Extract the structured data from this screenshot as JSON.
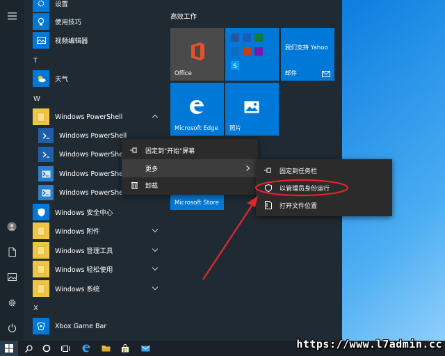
{
  "start_menu": {
    "apps": {
      "settings": "设置",
      "tips": "使用技巧",
      "video_editor": "视频编辑器",
      "letter_t": "T",
      "weather": "天气",
      "letter_w": "W",
      "powershell_folder": "Windows PowerShell",
      "ps_item_1": "Windows PowerShell",
      "ps_item_2": "Windows PowerShell",
      "ps_item_3": "Windows PowerShell",
      "ps_item_4": "Windows PowerShell",
      "security_center": "Windows 安全中心",
      "accessories": "Windows 附件",
      "admin_tools": "Windows 管理工具",
      "ease_of_access": "Windows 轻松使用",
      "system": "Windows 系统",
      "letter_x": "X",
      "xbox": "Xbox Game Bar"
    },
    "tiles": {
      "header": "高效工作",
      "office": "Office",
      "yahoo_text": "我们支持 Yahoo",
      "mail": "邮件",
      "edge": "Microsoft Edge",
      "photos": "照片",
      "store": "Microsoft Store"
    }
  },
  "context_menu": {
    "pin_start": "固定到\"开始\"屏幕",
    "more": "更多",
    "uninstall": "卸载"
  },
  "submenu": {
    "pin_taskbar": "固定到任务栏",
    "run_as_admin": "以管理员身份运行",
    "open_location": "打开文件位置"
  },
  "watermark": "https://www.l7admin.cc",
  "colors": {
    "menu_bg": "#1f2a33",
    "accent": "#0078d7",
    "office_tile": "#4a4a4a",
    "highlight_red": "#e0262b"
  }
}
